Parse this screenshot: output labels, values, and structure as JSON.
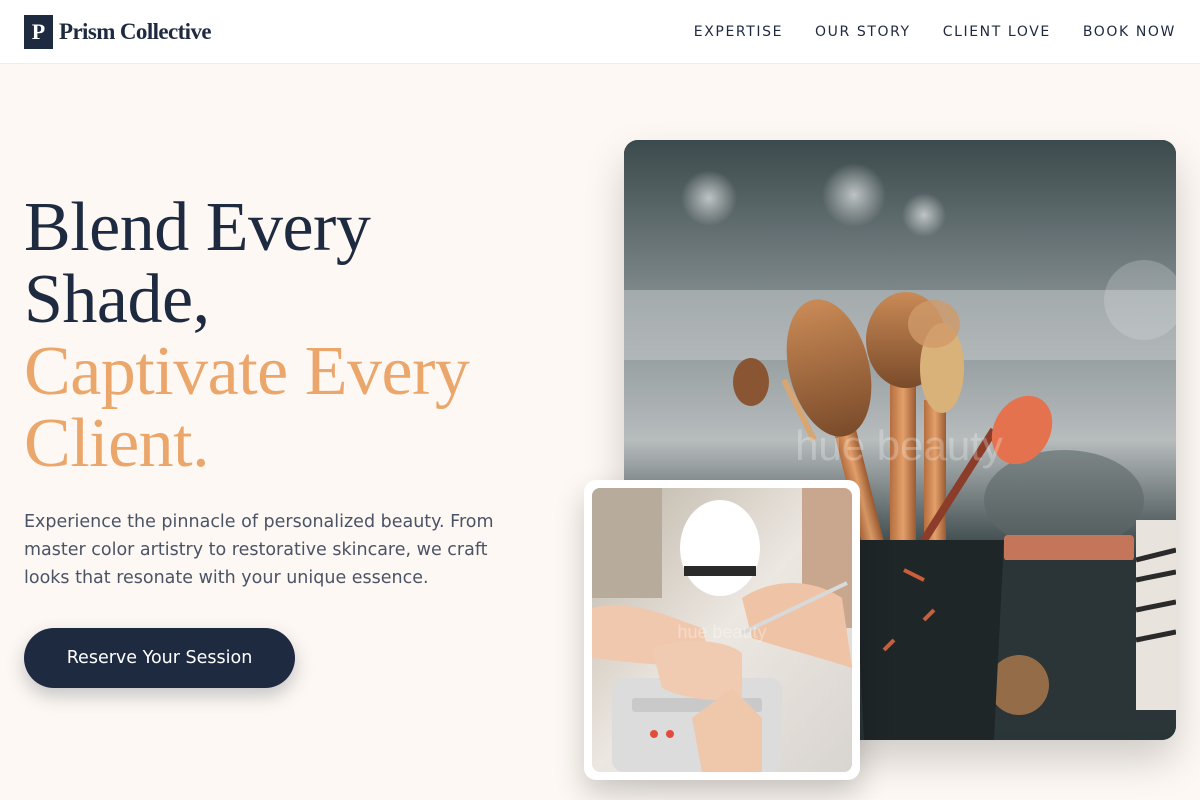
{
  "brand": {
    "logo_letter": "P",
    "name": "Prism Collective"
  },
  "nav": [
    "EXPERTISE",
    "OUR STORY",
    "CLIENT LOVE",
    "BOOK NOW"
  ],
  "hero": {
    "headline_line1": "Blend Every Shade,",
    "headline_line2": "Captivate Every Client.",
    "subtext": "Experience the pinnacle of personalized beauty. From master color artistry to restorative skincare, we craft looks that resonate with your unique essence.",
    "cta_label": "Reserve Your Session"
  },
  "images": {
    "main": "makeup-brushes-photo",
    "secondary": "nail-treatment-photo",
    "watermark": "hue beauty"
  },
  "colors": {
    "navy": "#1e2a40",
    "accent": "#eba76b",
    "background": "#fdf8f3"
  }
}
